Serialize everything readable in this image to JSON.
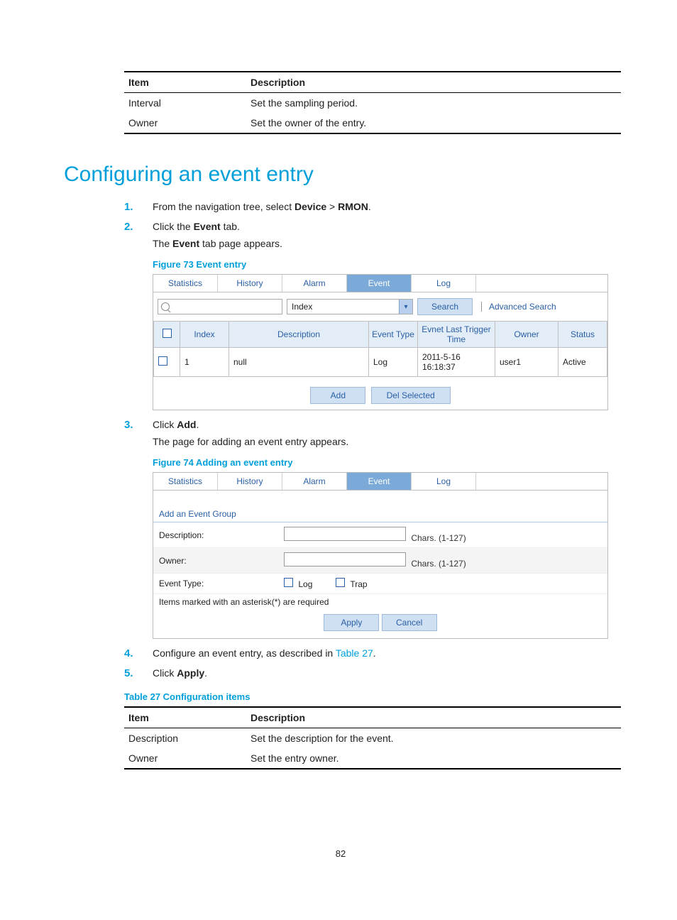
{
  "topTable": {
    "headItem": "Item",
    "headDesc": "Description",
    "rows": [
      {
        "item": "Interval",
        "desc": "Set the sampling period."
      },
      {
        "item": "Owner",
        "desc": "Set the owner of the entry."
      }
    ]
  },
  "heading": "Configuring an event entry",
  "steps": {
    "s1_pre": "From the navigation tree, select ",
    "s1_b1": "Device",
    "s1_mid": " > ",
    "s1_b2": "RMON",
    "s1_post": ".",
    "s2_pre": "Click the ",
    "s2_b": "Event",
    "s2_post": " tab.",
    "s2_sub_pre": "The ",
    "s2_sub_b": "Event",
    "s2_sub_post": " tab page appears.",
    "fig73_caption": "Figure 73 Event entry",
    "s3_pre": "Click ",
    "s3_b": "Add",
    "s3_post": ".",
    "s3_sub": "The page for adding an event entry appears.",
    "fig74_caption": "Figure 74 Adding an event entry",
    "s4_pre": "Configure an event entry, as described in ",
    "s4_link": "Table 27",
    "s4_post": ".",
    "s5_pre": "Click ",
    "s5_b": "Apply",
    "s5_post": "."
  },
  "fig73": {
    "tabs": [
      "Statistics",
      "History",
      "Alarm",
      "Event",
      "Log"
    ],
    "activeTab": "Event",
    "dropdownValue": "Index",
    "searchBtn": "Search",
    "advSearch": "Advanced Search",
    "gridHeaders": [
      "",
      "Index",
      "Description",
      "Event Type",
      "Evnet Last Trigger Time",
      "Owner",
      "Status"
    ],
    "gridRow": [
      "",
      "1",
      "null",
      "Log",
      "2011-5-16 16:18:37",
      "user1",
      "Active"
    ],
    "addBtn": "Add",
    "delBtn": "Del Selected"
  },
  "fig74": {
    "tabs": [
      "Statistics",
      "History",
      "Alarm",
      "Event",
      "Log"
    ],
    "activeTab": "Event",
    "formTitle": "Add an Event Group",
    "rows": {
      "descLabel": "Description:",
      "descHint": "Chars. (1-127)",
      "ownerLabel": "Owner:",
      "ownerHint": "Chars. (1-127)",
      "typeLabel": "Event Type:",
      "cbLog": "Log",
      "cbTrap": "Trap"
    },
    "note": "Items marked with an asterisk(*) are required",
    "applyBtn": "Apply",
    "cancelBtn": "Cancel"
  },
  "table27": {
    "caption": "Table 27 Configuration items",
    "headItem": "Item",
    "headDesc": "Description",
    "rows": [
      {
        "item": "Description",
        "desc": "Set the description for the event."
      },
      {
        "item": "Owner",
        "desc": "Set the entry owner."
      }
    ]
  },
  "pageNumber": "82"
}
